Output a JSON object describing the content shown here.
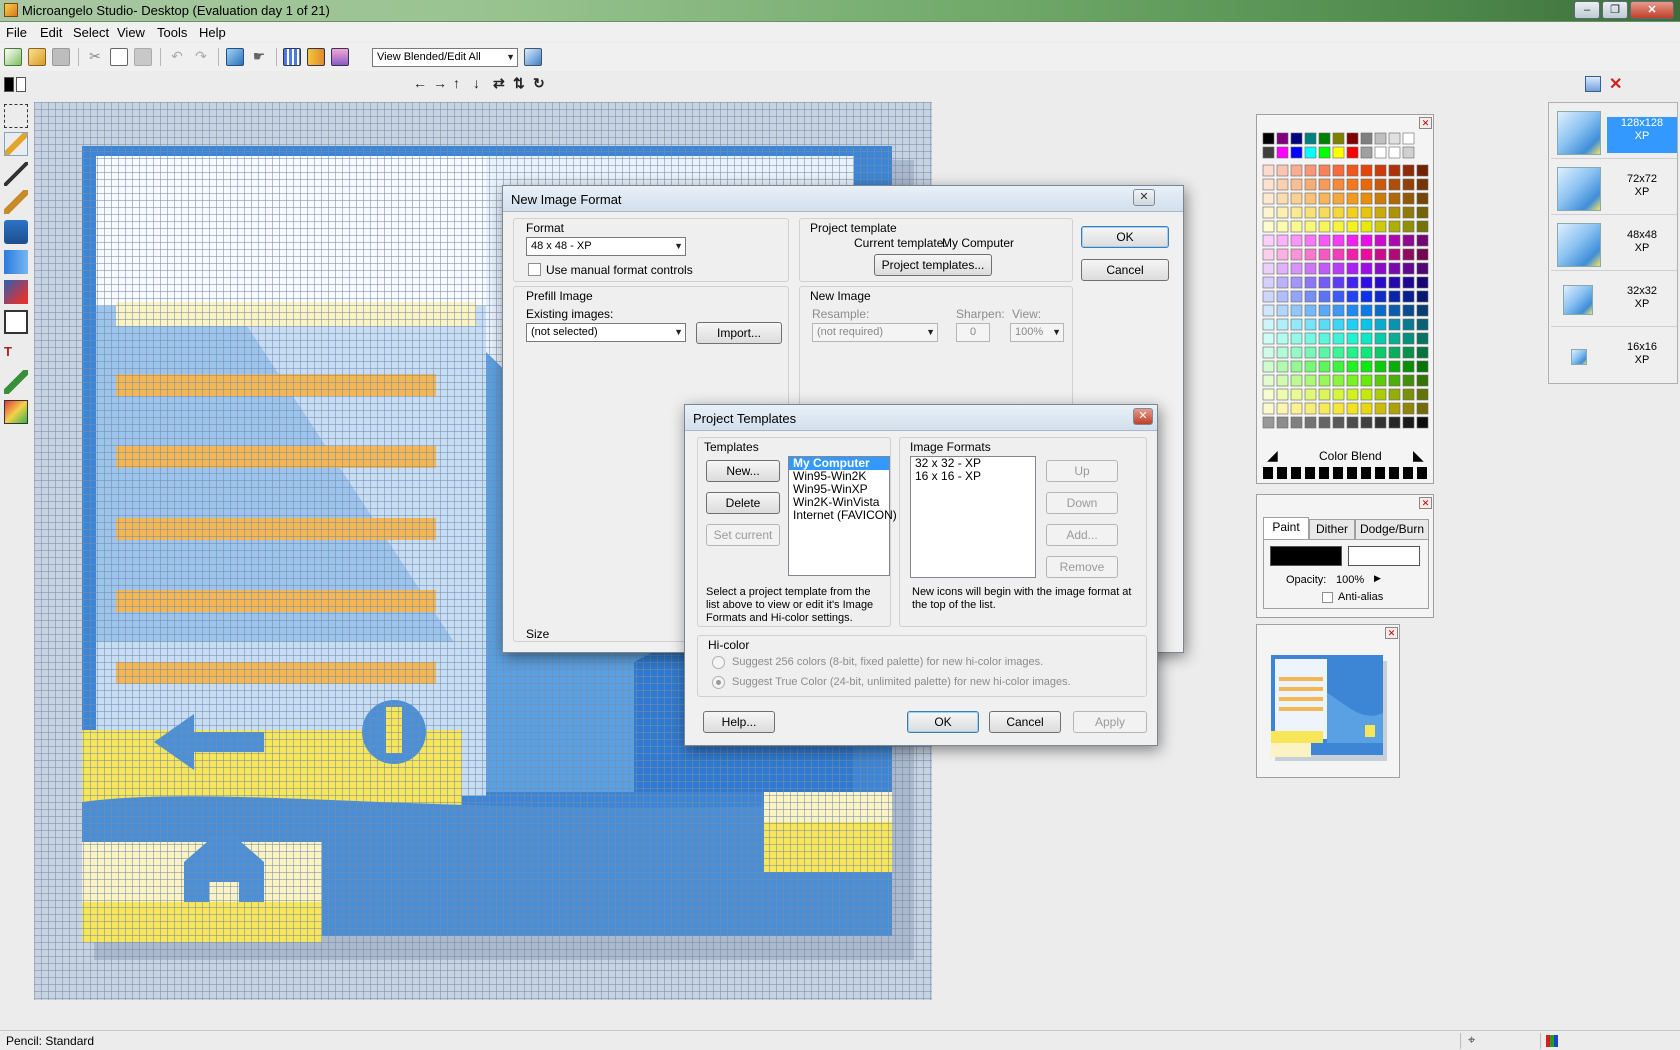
{
  "app": {
    "title": "Microangelo Studio- Desktop  (Evaluation day 1 of 21)"
  },
  "menu": [
    "File",
    "Edit",
    "Select",
    "View",
    "Tools",
    "Help"
  ],
  "toolbar": {
    "view_mode": "View Blended/Edit All"
  },
  "new_image_dialog": {
    "title": "New Image Format",
    "format_label": "Format",
    "format_value": "48 x 48 - XP",
    "manual_controls": "Use manual format controls",
    "project_template_label": "Project template",
    "current_template_label": "Current template:",
    "current_template_value": "My Computer",
    "project_templates_button": "Project templates...",
    "ok": "OK",
    "cancel": "Cancel",
    "prefill_label": "Prefill Image",
    "existing_images_label": "Existing images:",
    "existing_images_value": "(not selected)",
    "import_button": "Import...",
    "new_image_label": "New Image",
    "resample_label": "Resample:",
    "resample_value": "(not required)",
    "sharpen_label": "Sharpen:",
    "sharpen_value": "0",
    "view_label": "View:",
    "view_value": "100%",
    "size_label": "Size"
  },
  "project_templates_dialog": {
    "title": "Project Templates",
    "templates_label": "Templates",
    "new_button": "New...",
    "delete_button": "Delete",
    "set_current_button": "Set current",
    "templates": [
      "My Computer",
      "Win95-Win2K",
      "Win95-WinXP",
      "Win2K-WinVista",
      "Internet (FAVICON)"
    ],
    "templates_help": "Select a project template from the list above to view or edit it's Image Formats and Hi-color settings.",
    "image_formats_label": "Image Formats",
    "image_formats": [
      "32 x 32 - XP",
      "16 x 16 - XP"
    ],
    "up_button": "Up",
    "down_button": "Down",
    "add_button": "Add...",
    "remove_button": "Remove",
    "formats_help": "New icons will begin with the image format at the top of the list.",
    "hicolor_label": "Hi-color",
    "hicolor_option1": "Suggest 256 colors (8-bit, fixed palette) for new hi-color images.",
    "hicolor_option2": "Suggest True Color (24-bit, unlimited palette) for new hi-color images.",
    "help_button": "Help...",
    "ok_button": "OK",
    "cancel_button": "Cancel",
    "apply_button": "Apply"
  },
  "palette": {
    "color_blend_label": "Color Blend"
  },
  "paint_panel": {
    "tabs": [
      "Paint",
      "Dither",
      "Dodge/Burn"
    ],
    "opacity_label": "Opacity:",
    "opacity_value": "100%",
    "antialias_label": "Anti-alias"
  },
  "formats": [
    {
      "size": "128x128",
      "type": "XP"
    },
    {
      "size": "72x72",
      "type": "XP"
    },
    {
      "size": "48x48",
      "type": "XP"
    },
    {
      "size": "32x32",
      "type": "XP"
    },
    {
      "size": "16x16",
      "type": "XP"
    }
  ],
  "status": {
    "text": "Pencil: Standard"
  },
  "colors": {
    "accent": "#3399ff",
    "title_green": "#6fa869",
    "canvas_blue": "#4a90d9",
    "canvas_yellow": "#f6e04a",
    "canvas_orange": "#f2a436"
  }
}
